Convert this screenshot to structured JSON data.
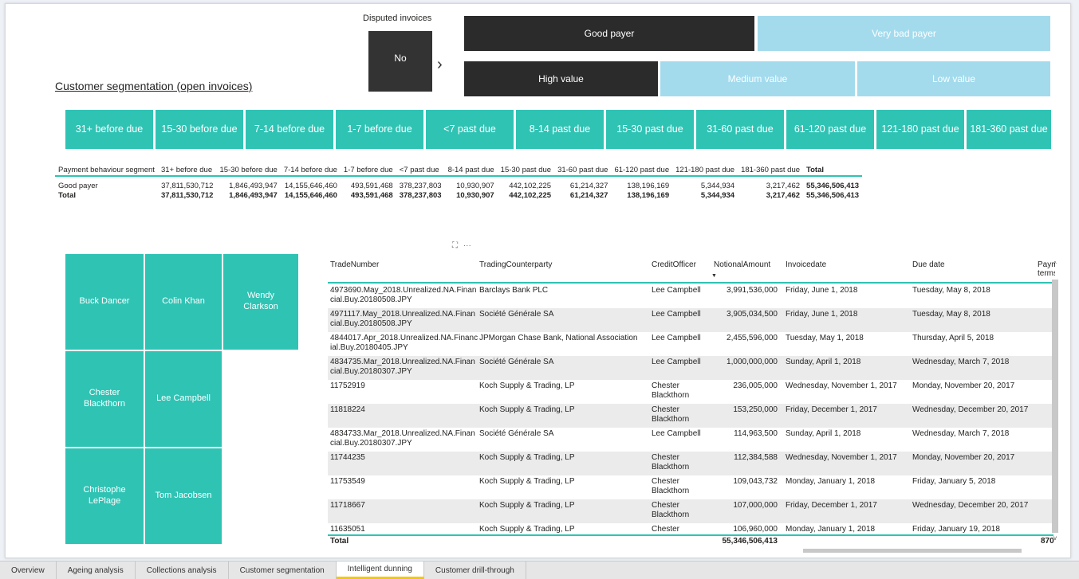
{
  "disputed": {
    "title": "Disputed invoices",
    "value": "No",
    "arrow": "›"
  },
  "payer_segments": [
    {
      "label": "Good payer",
      "selected": true
    },
    {
      "label": "Very bad payer",
      "selected": false
    }
  ],
  "value_segments": [
    {
      "label": "High value",
      "selected": true
    },
    {
      "label": "Medium value",
      "selected": false
    },
    {
      "label": "Low value",
      "selected": false
    }
  ],
  "page_title": "Customer segmentation (open invoices)",
  "age_buttons": [
    "31+ before due",
    "15-30 before due",
    "7-14 before due",
    "1-7 before due",
    "<7 past due",
    "8-14 past due",
    "15-30 past due",
    "31-60 past due",
    "61-120 past due",
    "121-180 past due",
    "181-360 past due"
  ],
  "matrix": {
    "row_header": "Payment behaviour segment",
    "columns": [
      "31+ before due",
      "15-30 before due",
      "7-14 before due",
      "1-7 before due",
      "<7 past due",
      "8-14 past due",
      "15-30 past due",
      "31-60 past due",
      "61-120 past due",
      "121-180 past due",
      "181-360 past due",
      "Total"
    ],
    "rows": [
      {
        "label": "Good payer",
        "values": [
          "37,811,530,712",
          "1,846,493,947",
          "14,155,646,460",
          "493,591,468",
          "378,237,803",
          "10,930,907",
          "442,102,225",
          "61,214,327",
          "138,196,169",
          "5,344,934",
          "3,217,462",
          "55,346,506,413"
        ]
      },
      {
        "label": "Total",
        "values": [
          "37,811,530,712",
          "1,846,493,947",
          "14,155,646,460",
          "493,591,468",
          "378,237,803",
          "10,930,907",
          "442,102,225",
          "61,214,327",
          "138,196,169",
          "5,344,934",
          "3,217,462",
          "55,346,506,413"
        ]
      }
    ]
  },
  "visual_icons": {
    "focus": "⛶",
    "more": "···"
  },
  "treemap": [
    "Buck Dancer",
    "Colin Khan",
    "Wendy Clarkson",
    "Chester Blackthorn",
    "Lee Campbell",
    "Christophe LePlage",
    "Tom Jacobsen"
  ],
  "table": {
    "columns": [
      "TradeNumber",
      "TradingCounterparty",
      "CreditOfficer",
      "NotionalAmount",
      "Invoicedate",
      "Due date",
      "Payment terms"
    ],
    "rows": [
      [
        "4973690.May_2018.Unrealized.NA.Financial.Buy.20180508.JPY",
        "Barclays Bank PLC",
        "Lee Campbell",
        "3,991,536,000",
        "Friday, June 1, 2018",
        "Tuesday, May 8, 2018"
      ],
      [
        "4971117.May_2018.Unrealized.NA.Financial.Buy.20180508.JPY",
        "Société Générale SA",
        "Lee Campbell",
        "3,905,034,500",
        "Friday, June 1, 2018",
        "Tuesday, May 8, 2018"
      ],
      [
        "4844017.Apr_2018.Unrealized.NA.Financial.Buy.20180405.JPY",
        "JPMorgan Chase Bank, National Association",
        "Lee Campbell",
        "2,455,596,000",
        "Tuesday, May 1, 2018",
        "Thursday, April 5, 2018"
      ],
      [
        "4834735.Mar_2018.Unrealized.NA.Financial.Buy.20180307.JPY",
        "Société Générale SA",
        "Lee Campbell",
        "1,000,000,000",
        "Sunday, April 1, 2018",
        "Wednesday, March 7, 2018"
      ],
      [
        "11752919",
        "Koch Supply & Trading, LP",
        "Chester Blackthorn",
        "236,005,000",
        "Wednesday, November 1, 2017",
        "Monday, November 20, 2017"
      ],
      [
        "11818224",
        "Koch Supply & Trading, LP",
        "Chester Blackthorn",
        "153,250,000",
        "Friday, December 1, 2017",
        "Wednesday, December 20, 2017"
      ],
      [
        "4834733.Mar_2018.Unrealized.NA.Financial.Buy.20180307.JPY",
        "Société Générale SA",
        "Lee Campbell",
        "114,963,500",
        "Sunday, April 1, 2018",
        "Wednesday, March 7, 2018"
      ],
      [
        "11744235",
        "Koch Supply & Trading, LP",
        "Chester Blackthorn",
        "112,384,588",
        "Wednesday, November 1, 2017",
        "Monday, November 20, 2017"
      ],
      [
        "11753549",
        "Koch Supply & Trading, LP",
        "Chester Blackthorn",
        "109,043,732",
        "Monday, January 1, 2018",
        "Friday, January 5, 2018"
      ],
      [
        "11718667",
        "Koch Supply & Trading, LP",
        "Chester Blackthorn",
        "107,000,000",
        "Friday, December 1, 2017",
        "Wednesday, December 20, 2017"
      ],
      [
        "11635051",
        "Koch Supply & Trading, LP",
        "Chester",
        "106,960,000",
        "Monday, January 1, 2018",
        "Friday, January 19, 2018"
      ]
    ],
    "total_label": "Total",
    "total_amount": "55,346,506,413",
    "total_cut": "870"
  },
  "tabs": [
    {
      "label": "Overview",
      "active": false
    },
    {
      "label": "Ageing analysis",
      "active": false
    },
    {
      "label": "Collections analysis",
      "active": false
    },
    {
      "label": "Customer segmentation",
      "active": false
    },
    {
      "label": "Intelligent dunning",
      "active": true
    },
    {
      "label": "Customer drill-through",
      "active": false
    }
  ],
  "colors": {
    "teal": "#2fc3b4",
    "dark": "#2b2b2b",
    "light_blue": "#a3dbed",
    "tab_accent": "#f2c811"
  }
}
